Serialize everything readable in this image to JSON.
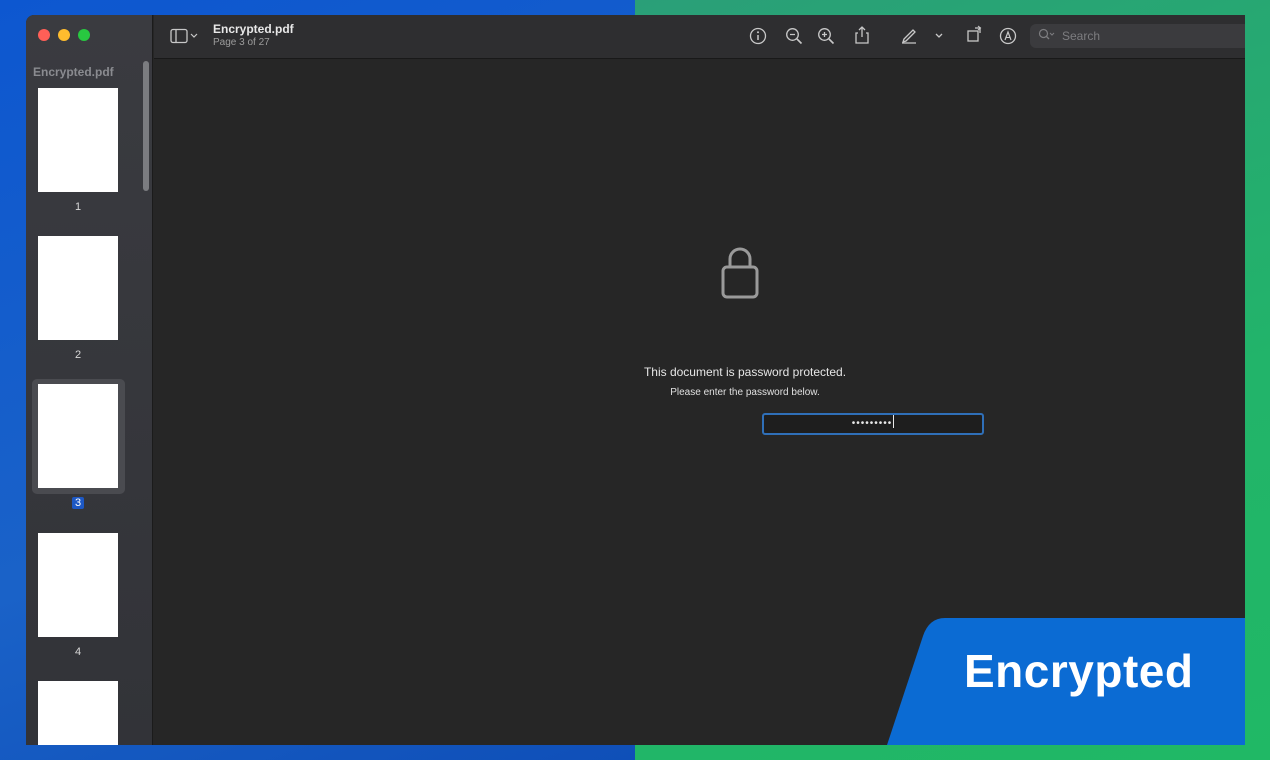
{
  "window": {
    "sidebar_title": "Encrypted.pdf",
    "doc_title": "Encrypted.pdf",
    "doc_subtitle": "Page 3 of 27"
  },
  "toolbar": {
    "icons": [
      "sidebar-toggle-icon",
      "info-icon",
      "zoom-out-icon",
      "zoom-in-icon",
      "share-icon",
      "highlight-icon",
      "rotate-icon",
      "markup-icon"
    ],
    "search_placeholder": "Search"
  },
  "thumbnails": [
    {
      "label": "1",
      "selected": false
    },
    {
      "label": "2",
      "selected": false
    },
    {
      "label": "3",
      "selected": true
    },
    {
      "label": "4",
      "selected": false
    }
  ],
  "main": {
    "message": "This document is password protected.",
    "instruction": "Please enter the password below.",
    "password_mask": "•••••••••"
  },
  "badge": {
    "text": "Encrypted",
    "color": "#0b6bd3"
  }
}
